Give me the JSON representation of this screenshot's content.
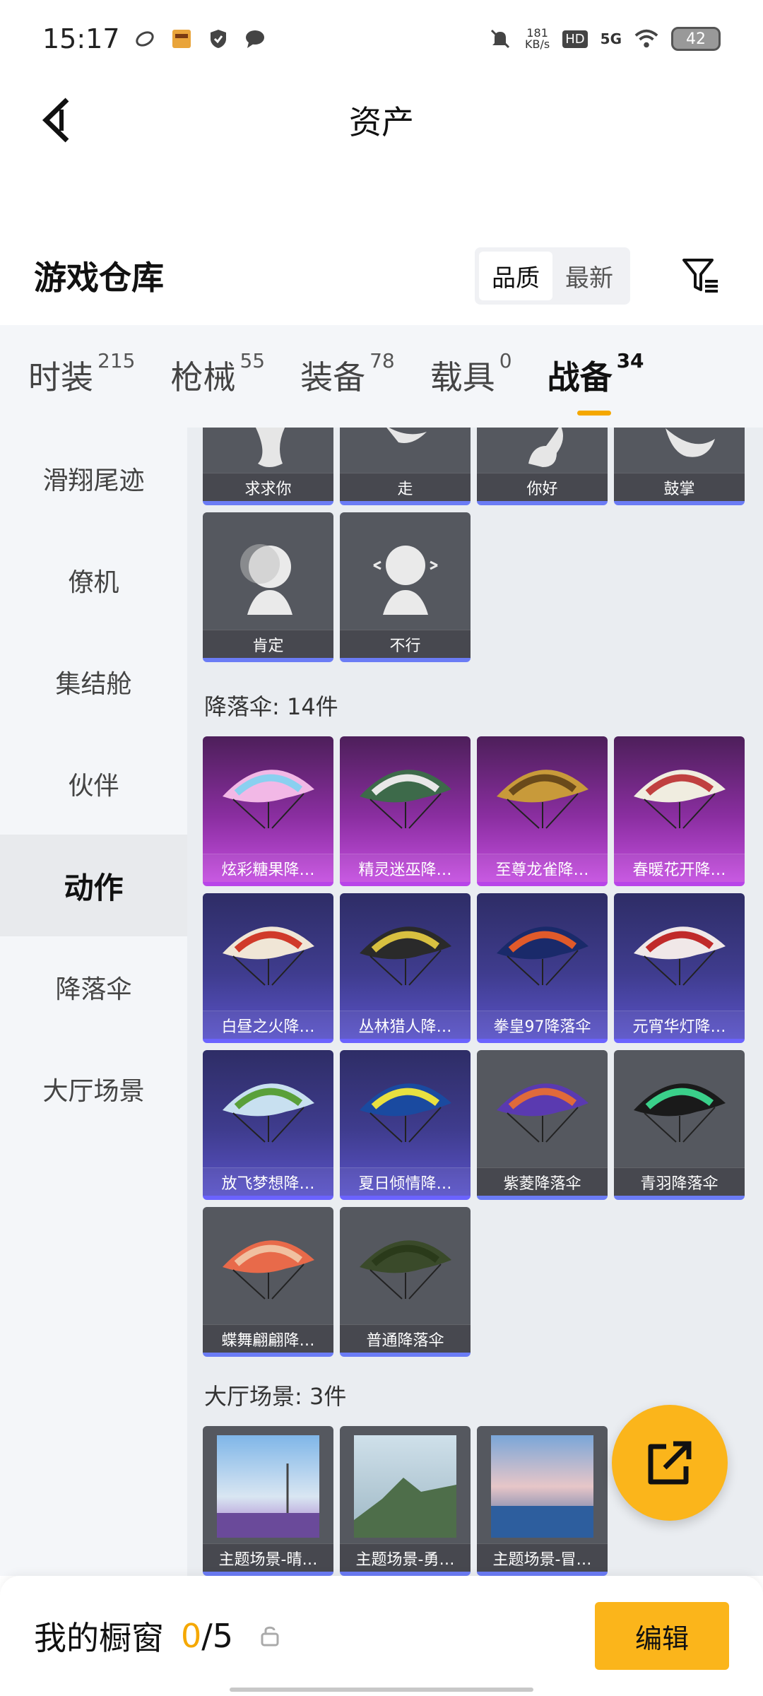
{
  "status_bar": {
    "time": "15:17",
    "net_speed_value": "181",
    "net_speed_unit": "KB/s",
    "hd_label": "HD",
    "network": "5G",
    "battery": "42"
  },
  "header": {
    "title": "资产"
  },
  "warehouse": {
    "title": "游戏仓库",
    "sort_options": [
      "品质",
      "最新"
    ],
    "active_sort": "品质"
  },
  "tabs": [
    {
      "label": "时装",
      "count": "215"
    },
    {
      "label": "枪械",
      "count": "55"
    },
    {
      "label": "装备",
      "count": "78"
    },
    {
      "label": "载具",
      "count": "0"
    },
    {
      "label": "战备",
      "count": "34",
      "active": true
    }
  ],
  "sidebar": {
    "items": [
      "滑翔尾迹",
      "僚机",
      "集结舱",
      "伙伴",
      "动作",
      "降落伞",
      "大厅场景"
    ],
    "active": "动作"
  },
  "emotes": {
    "items": [
      "求求你",
      "走",
      "你好",
      "鼓掌",
      "肯定",
      "不行"
    ]
  },
  "parachutes": {
    "section_title": "降落伞: 14件",
    "items": [
      {
        "name": "炫彩糖果降…",
        "tier": "purple"
      },
      {
        "name": "精灵迷巫降…",
        "tier": "purple"
      },
      {
        "name": "至尊龙雀降…",
        "tier": "purple"
      },
      {
        "name": "春暖花开降…",
        "tier": "purple"
      },
      {
        "name": "白昼之火降…",
        "tier": "blue"
      },
      {
        "name": "丛林猎人降…",
        "tier": "blue"
      },
      {
        "name": "拳皇97降落伞",
        "tier": "blue"
      },
      {
        "name": "元宵华灯降…",
        "tier": "blue"
      },
      {
        "name": "放飞梦想降…",
        "tier": "blue"
      },
      {
        "name": "夏日倾情降…",
        "tier": "blue"
      },
      {
        "name": "紫菱降落伞",
        "tier": "gray"
      },
      {
        "name": "青羽降落伞",
        "tier": "gray"
      },
      {
        "name": "蝶舞翩翩降…",
        "tier": "gray"
      },
      {
        "name": "普通降落伞",
        "tier": "gray"
      }
    ]
  },
  "lobby_scenes": {
    "section_title": "大厅场景: 3件",
    "items": [
      "主题场景-晴…",
      "主题场景-勇…",
      "主题场景-冒…"
    ]
  },
  "showcase": {
    "title": "我的橱窗",
    "current": "0",
    "separator_total": "/5",
    "edit_label": "编辑"
  },
  "colors": {
    "accent": "#fbb51b",
    "tab_underline": "#f5a800",
    "purple_tier": "#b845e8",
    "blue_tier": "#6b63ff"
  }
}
